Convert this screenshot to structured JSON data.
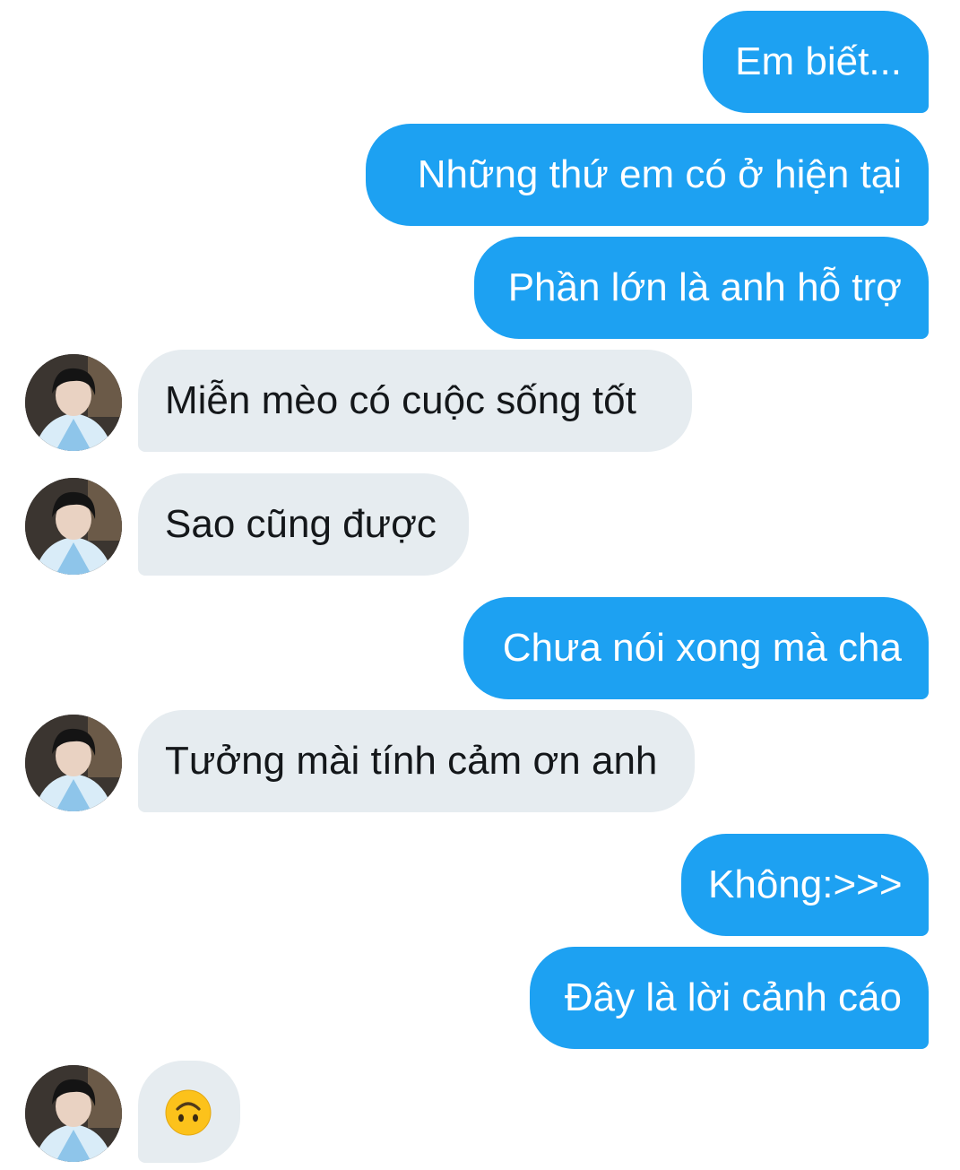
{
  "messages": [
    {
      "side": "out",
      "text": "Em biết..."
    },
    {
      "side": "out",
      "text": "Những thứ em có ở hiện tại"
    },
    {
      "side": "out",
      "text": "Phần lớn là anh hỗ trợ"
    },
    {
      "side": "in",
      "text": "Miễn mèo có cuộc sống tốt"
    },
    {
      "side": "in",
      "text": "Sao cũng được"
    },
    {
      "side": "out",
      "text": "Chưa nói xong mà cha"
    },
    {
      "side": "in",
      "text": "Tưởng mài tính cảm ơn anh"
    },
    {
      "side": "out",
      "text": "Không:>>>"
    },
    {
      "side": "out",
      "text": "Đây là lời cảnh cáo"
    },
    {
      "side": "in",
      "text": "",
      "icon": "upside-down-face-emoji"
    }
  ],
  "colors": {
    "outgoing_bubble": "#1da1f2",
    "outgoing_text": "#ffffff",
    "incoming_bubble": "#e6ecf0",
    "incoming_text": "#14171a"
  }
}
